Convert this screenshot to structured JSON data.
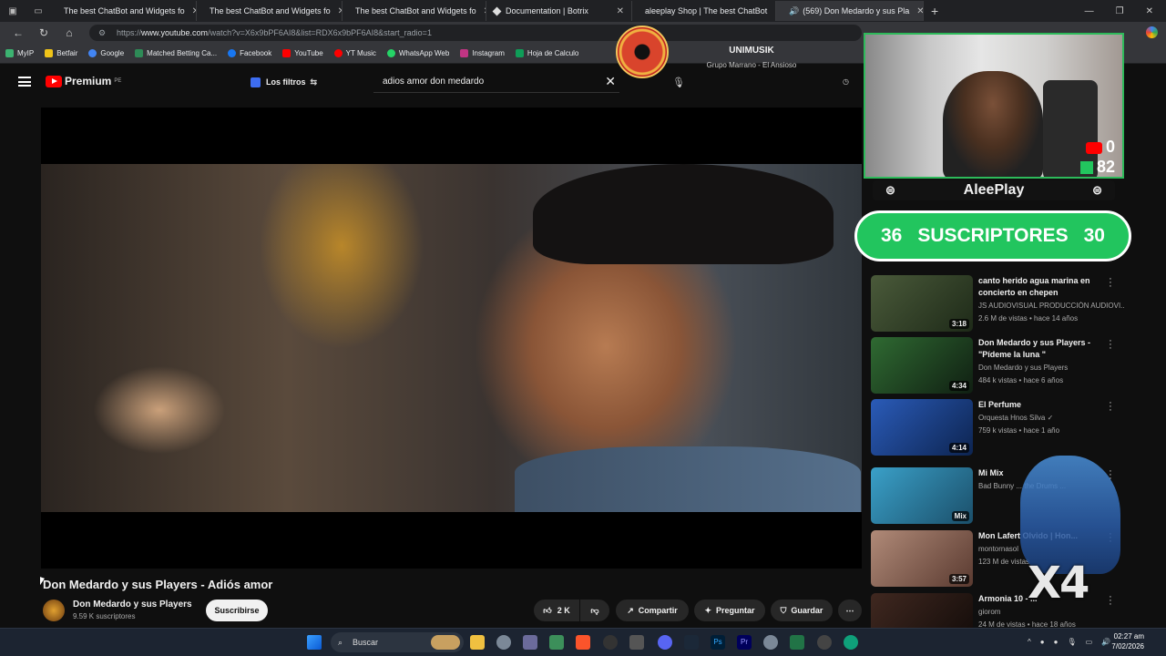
{
  "browser": {
    "tabs": [
      {
        "title": "The best ChatBot and Widgets fo",
        "favicon": "diamond-icon"
      },
      {
        "title": "The best ChatBot and Widgets fo",
        "favicon": "diamond-icon"
      },
      {
        "title": "The best ChatBot and Widgets fo",
        "favicon": "diamond-icon"
      },
      {
        "title": "Documentation | Botrix",
        "favicon": "diamond-icon"
      },
      {
        "title": "aleeplay Shop | The best ChatBot",
        "favicon": "diamond-icon"
      },
      {
        "title": "(569) Don Medardo y sus Pla",
        "favicon": "youtube-icon"
      }
    ],
    "url_prefix": "https://",
    "url_host": "www.youtube.com",
    "url_path": "/watch?v=X6x9bPF6AI8&list=RDX6x9bPF6AI8&start_radio=1",
    "bookmarks": [
      {
        "label": "MyIP",
        "color": "#3cb371"
      },
      {
        "label": "Betfair",
        "color": "#f0c419"
      },
      {
        "label": "Google",
        "color": "#4285f4"
      },
      {
        "label": "Matched Betting Ca...",
        "color": "#2e8b57"
      },
      {
        "label": "Facebook",
        "color": "#1877f2"
      },
      {
        "label": "YouTube",
        "color": "#ff0000"
      },
      {
        "label": "YT Music",
        "color": "#ff0000"
      },
      {
        "label": "WhatsApp Web",
        "color": "#25d366"
      },
      {
        "label": "Instagram",
        "color": "#c13584"
      },
      {
        "label": "Hoja de Calculo",
        "color": "#0f9d58"
      }
    ]
  },
  "youtube": {
    "logo_text": "Premium",
    "logo_region": "PE",
    "filters_label": "Los filtros",
    "search_value": "adios amor don medardo",
    "video_title": "Don Medardo y sus Players - Adiós amor",
    "channel_name": "Don Medardo y sus Players",
    "channel_subs": "9.59 K suscriptores",
    "subscribe_label": "Suscribirse",
    "likes": "2 K",
    "share_label": "Compartir",
    "ask_label": "Preguntar",
    "save_label": "Guardar",
    "more_label": "⋯"
  },
  "recommendations": [
    {
      "title": "canto herido agua marina en concierto en chepen",
      "channel": "JS AUDIOVISUAL PRODUCCIÓN AUDIOVI...",
      "meta": "2.6 M de vistas • hace 14 años",
      "duration": "3:18",
      "color1": "#4a5a3a",
      "color2": "#1e2a18"
    },
    {
      "title": "Don Medardo y sus Players - \"Pídeme la luna \"",
      "channel": "Don Medardo y sus Players",
      "meta": "484 k vistas • hace 6 años",
      "duration": "4:34",
      "color1": "#2f6a32",
      "color2": "#101f12"
    },
    {
      "title": "El Perfume",
      "channel": "Orquesta Hnos Silva ✓",
      "meta": "759 k vistas • hace 1 año",
      "duration": "4:14",
      "color1": "#2a5bb8",
      "color2": "#0d2450"
    },
    {
      "title": "Mi Mix",
      "channel": "Bad Bunny ... the Drums ...",
      "meta": "",
      "duration": "Mix",
      "color1": "#3aa0c8",
      "color2": "#1b4f6a"
    },
    {
      "title": "Mon Lafert Olvido | Hon...",
      "channel": "montornasol",
      "meta": "123 M de vistas",
      "duration": "3:57",
      "color1": "#b08a78",
      "color2": "#5a3a30"
    },
    {
      "title": "Armonia 10 - ...",
      "channel": "giorom",
      "meta": "24 M de vistas • hace 18 años",
      "duration": "",
      "color1": "#402820",
      "color2": "#100a08"
    }
  ],
  "overlay": {
    "music_title": "UNIMUSIK",
    "music_subtitle": "Grupo Marrano - El Ansioso",
    "yt_count": "0",
    "kick_count": "82",
    "streamer_handle": "AleePlay",
    "subs_left": "36",
    "subs_label": "SUSCRIPTORES",
    "subs_right": "30",
    "combo": "X4"
  },
  "taskbar": {
    "search_placeholder": "Buscar",
    "time": "02:27 am",
    "date": "7/02/2026"
  },
  "colors": {
    "yt_red": "#ff0000",
    "subs_green": "#22c55e",
    "cam_border": "#2dba5a"
  }
}
